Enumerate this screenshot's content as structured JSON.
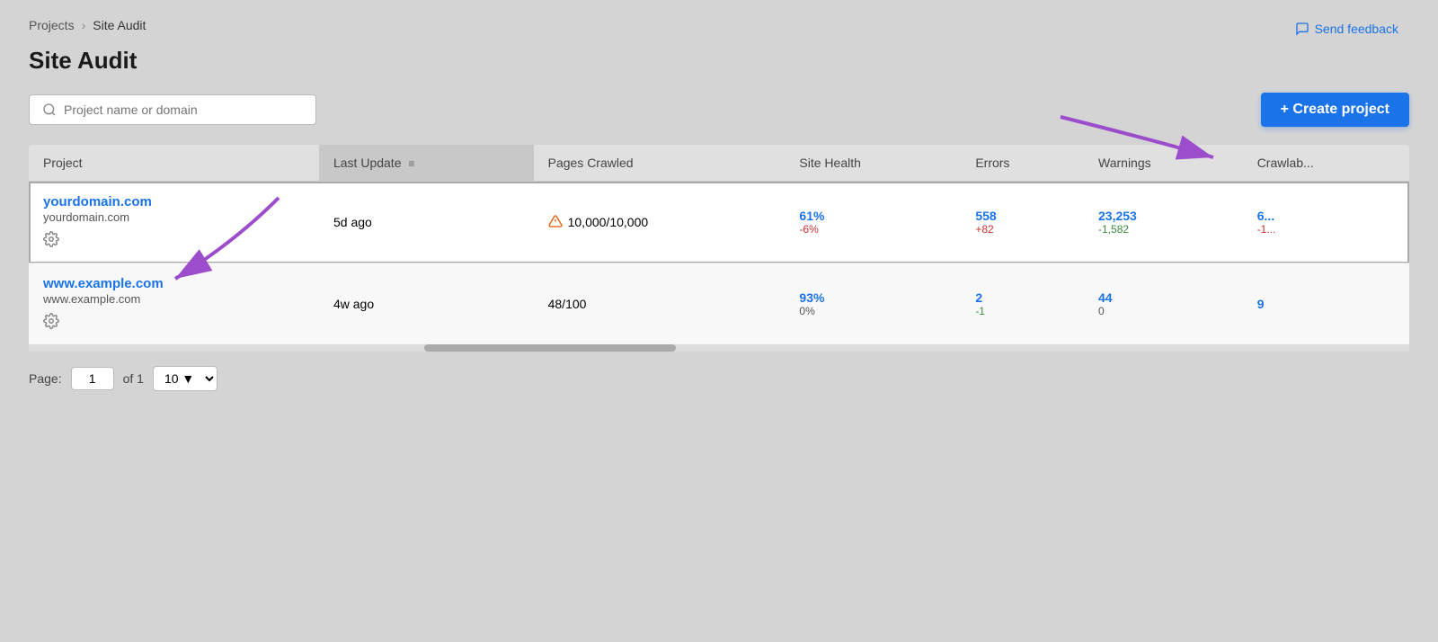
{
  "breadcrumb": {
    "parent": "Projects",
    "separator": "›",
    "current": "Site Audit"
  },
  "page": {
    "title": "Site Audit"
  },
  "header": {
    "send_feedback_label": "Send feedback",
    "send_feedback_icon": "chat-icon"
  },
  "toolbar": {
    "search_placeholder": "Project name or domain",
    "search_icon": "search-icon",
    "create_project_label": "+ Create project"
  },
  "table": {
    "columns": [
      {
        "id": "project",
        "label": "Project",
        "sorted": false
      },
      {
        "id": "last_update",
        "label": "Last Update",
        "sorted": true
      },
      {
        "id": "pages_crawled",
        "label": "Pages Crawled",
        "sorted": false
      },
      {
        "id": "site_health",
        "label": "Site Health",
        "sorted": false
      },
      {
        "id": "errors",
        "label": "Errors",
        "sorted": false
      },
      {
        "id": "warnings",
        "label": "Warnings",
        "sorted": false
      },
      {
        "id": "crawlability",
        "label": "Crawlab...",
        "sorted": false
      }
    ],
    "rows": [
      {
        "id": "row1",
        "highlighted": true,
        "project_name": "yourdomain.com",
        "project_url": "yourdomain.com",
        "last_update": "5d ago",
        "pages_crawled_main": "10,000/10,000",
        "pages_crawled_warning": true,
        "site_health_main": "61%",
        "site_health_change": "-6%",
        "site_health_change_type": "negative",
        "errors_main": "558",
        "errors_change": "+82",
        "errors_change_type": "negative",
        "warnings_main": "23,253",
        "warnings_change": "-1,582",
        "warnings_change_type": "positive",
        "crawlability_main": "6...",
        "crawlability_change": "-1..."
      },
      {
        "id": "row2",
        "highlighted": false,
        "project_name": "www.example.com",
        "project_url": "www.example.com",
        "last_update": "4w ago",
        "pages_crawled_main": "48/100",
        "pages_crawled_warning": false,
        "site_health_main": "93%",
        "site_health_change": "0%",
        "site_health_change_type": "neutral",
        "errors_main": "2",
        "errors_change": "-1",
        "errors_change_type": "positive",
        "warnings_main": "44",
        "warnings_change": "0",
        "warnings_change_type": "neutral",
        "crawlability_main": "9",
        "crawlability_change": ""
      }
    ]
  },
  "pagination": {
    "page_label": "Page:",
    "current_page": "1",
    "of_label": "of 1",
    "page_size": "10"
  }
}
